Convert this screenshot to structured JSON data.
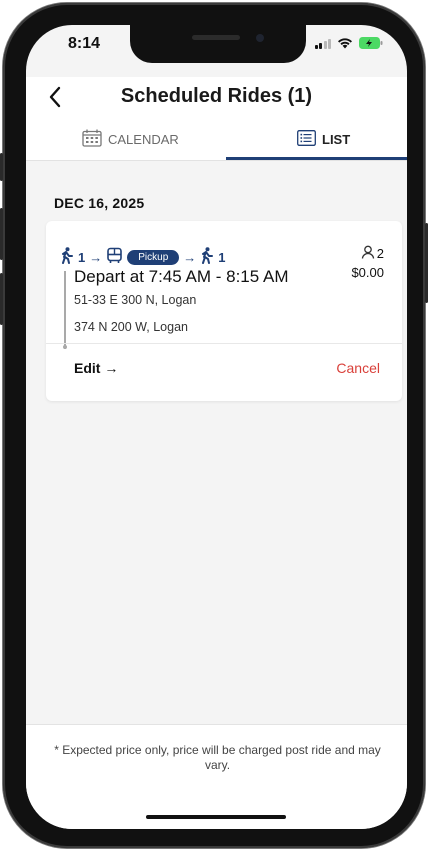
{
  "status_bar": {
    "time": "8:14"
  },
  "header": {
    "title": "Scheduled Rides (1)"
  },
  "tabs": [
    {
      "label": "CALENDAR",
      "active": false
    },
    {
      "label": "LIST",
      "active": true
    }
  ],
  "rides": {
    "date": "DEC 16, 2025",
    "ride": {
      "walk_before": "1",
      "mode_label": "Pickup",
      "walk_after": "1",
      "passengers": "2",
      "price": "$0.00",
      "depart": "Depart at 7:45 AM - 8:15 AM",
      "from": "51-33 E 300 N, Logan",
      "to": "374 N 200 W, Logan",
      "edit_label": "Edit →",
      "cancel_label": "Cancel"
    }
  },
  "footer": {
    "note": "* Expected price only, price will be charged post ride and may vary."
  },
  "colors": {
    "accent": "#1f3f76",
    "cancel": "#d9403a"
  }
}
